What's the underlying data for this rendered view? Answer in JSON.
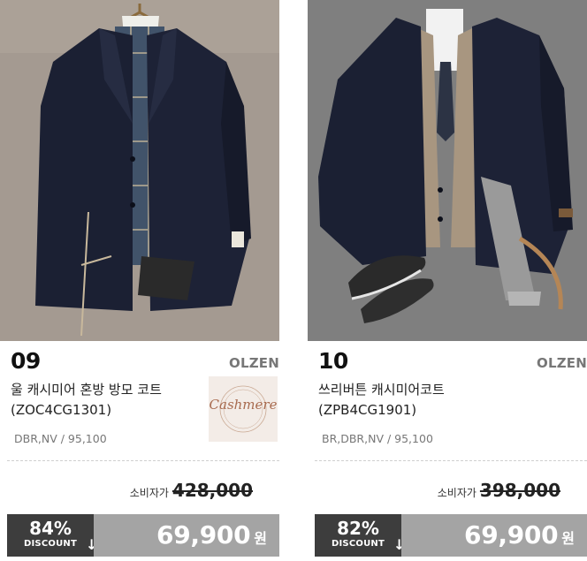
{
  "products": [
    {
      "number": "09",
      "brand": "OLZEN",
      "name_line1": "울 캐시미어 혼방 방모 코트",
      "name_line2": "(ZOC4CG1301)",
      "options": "DBR,NV / 95,100",
      "badge_text": "Cashmere",
      "badge_ring_text": "PREMIUM",
      "msrp_label": "소비자가",
      "msrp_price": "428,000",
      "discount_percent": "84%",
      "discount_label": "DISCOUNT",
      "sale_price": "69,900",
      "currency": "원",
      "photo_icon": "wool-cashmere-coat-photo"
    },
    {
      "number": "10",
      "brand": "OLZEN",
      "name_line1": "쓰리버튼 캐시미어코트",
      "name_line2": "(ZPB4CG1901)",
      "options": "BR,DBR,NV / 95,100",
      "msrp_label": "소비자가",
      "msrp_price": "398,000",
      "discount_percent": "82%",
      "discount_label": "DISCOUNT",
      "sale_price": "69,900",
      "currency": "원",
      "photo_icon": "three-button-cashmere-coat-photo"
    }
  ],
  "colors": {
    "discount_bg": "#3d3d3d",
    "price_bg": "#a4a4a4",
    "photo1_bg": "#a49a91",
    "photo2_bg": "#7c7c7c",
    "coat": "#1b2033"
  }
}
